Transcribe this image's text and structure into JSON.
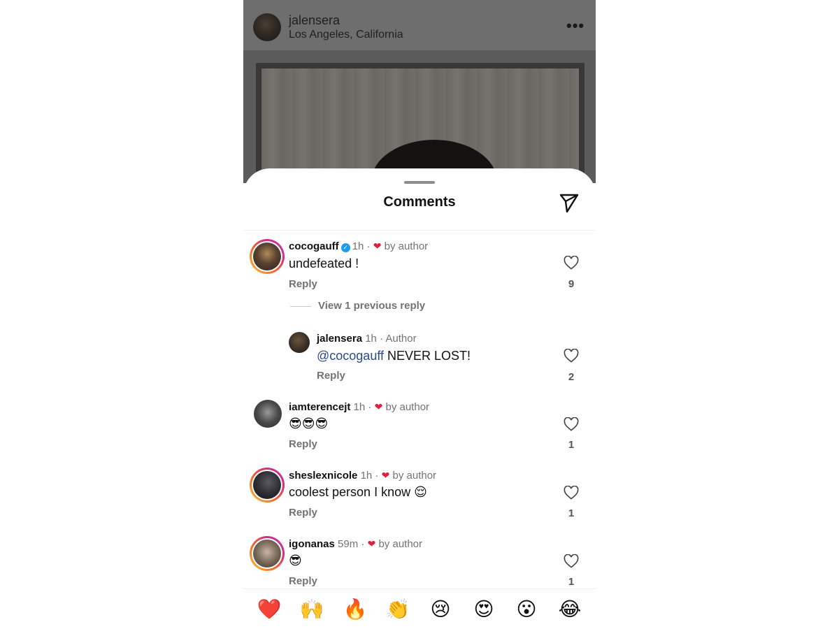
{
  "post": {
    "username": "jalensera",
    "location": "Los Angeles, California",
    "more_label": "•••"
  },
  "sheet": {
    "title": "Comments"
  },
  "comments": [
    {
      "username": "cocogauff",
      "verified": true,
      "time": "1h",
      "sep": "·",
      "badge": "by author",
      "text": "undefeated !",
      "reply": "Reply",
      "likes": "9"
    },
    {
      "username": "jalensera",
      "time": "1h",
      "sep": "·",
      "badge": "Author",
      "mention": "@cocogauff",
      "text": " NEVER LOST!",
      "reply": "Reply",
      "likes": "2"
    },
    {
      "username": "iamterencejt",
      "time": "1h",
      "sep": "·",
      "badge": "by author",
      "text": "😎😎😎",
      "reply": "Reply",
      "likes": "1"
    },
    {
      "username": "sheslexnicole",
      "time": "1h",
      "sep": "·",
      "badge": "by author",
      "text": "coolest person I know 😌",
      "reply": "Reply",
      "likes": "1"
    },
    {
      "username": "igonanas",
      "time": "59m",
      "sep": "·",
      "badge": "by author",
      "text": "😎",
      "reply": "Reply",
      "likes": "1"
    }
  ],
  "view_replies": "View 1 previous reply",
  "emoji_bar": [
    "❤️",
    "🙌",
    "🔥",
    "👏",
    "😢",
    "😍",
    "😮",
    "😂"
  ],
  "colors": {
    "heart": "#e01e3c",
    "verified": "#1d9bf0",
    "mention": "#2b4a8b"
  }
}
